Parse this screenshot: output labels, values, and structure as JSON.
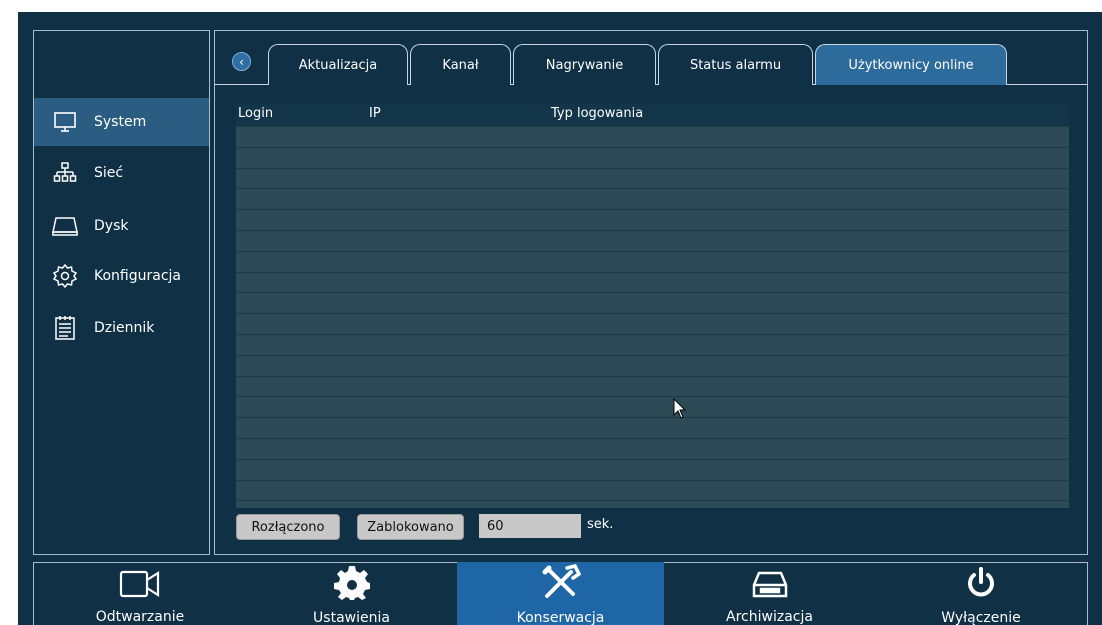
{
  "sidebar": {
    "items": [
      {
        "label": "System",
        "icon": "monitor-icon",
        "active": true
      },
      {
        "label": "Sieć",
        "icon": "network-icon"
      },
      {
        "label": "Dysk",
        "icon": "disk-icon"
      },
      {
        "label": "Konfiguracja",
        "icon": "gear-outline-icon"
      },
      {
        "label": "Dziennik",
        "icon": "log-icon"
      }
    ]
  },
  "tabs": {
    "back_icon": "‹",
    "items": [
      {
        "label": "Aktualizacja"
      },
      {
        "label": "Kanał"
      },
      {
        "label": "Nagrywanie"
      },
      {
        "label": "Status alarmu"
      },
      {
        "label": "Użytkownicy online",
        "active": true
      }
    ]
  },
  "table": {
    "columns": [
      "Login",
      "IP",
      "Typ logowania"
    ],
    "rows": []
  },
  "controls": {
    "disconnect_label": "Rozłączono",
    "block_label": "Zablokowano",
    "timeout_value": "60",
    "timeout_unit": "sek."
  },
  "bottom_nav": {
    "items": [
      {
        "label": "Odtwarzanie",
        "icon": "camera-icon"
      },
      {
        "label": "Ustawienia",
        "icon": "gear-icon"
      },
      {
        "label": "Konserwacja",
        "icon": "tools-icon",
        "active": true
      },
      {
        "label": "Archiwizacja",
        "icon": "archive-icon"
      },
      {
        "label": "Wyłączenie",
        "icon": "power-icon"
      }
    ]
  },
  "colors": {
    "background": "#0f3045",
    "active": "#2b5c82",
    "nav_active": "#1f66a6",
    "table": "#2c4b57"
  }
}
